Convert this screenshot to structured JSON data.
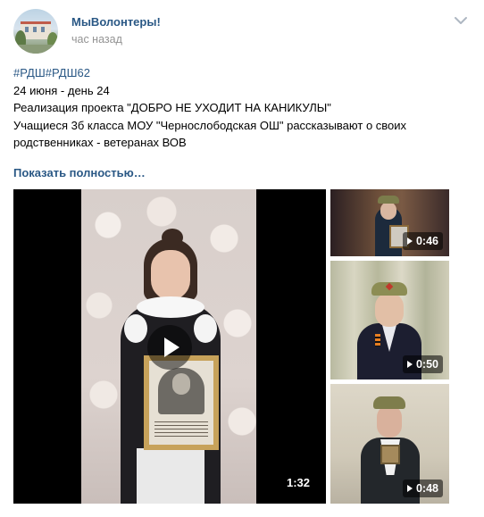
{
  "header": {
    "group_name": "МыВолонтеры!",
    "timestamp": "час назад",
    "menu_icon": "chevron-down-icon"
  },
  "post": {
    "lines": [
      "#РДШ#РДШ62",
      "24 июня - день 24",
      "Реализация проекта \"ДОБРО НЕ УХОДИТ НА КАНИКУЛЫ\"",
      "Учащиеся 3б класса МОУ \"Чернослободская ОШ\" рассказывают о своих",
      "родственниках - ветеранах ВОВ"
    ],
    "show_more": "Показать полностью…"
  },
  "videos": {
    "main": {
      "duration": "1:32",
      "play_icon": "play-icon"
    },
    "thumb1": {
      "duration": "0:46"
    },
    "thumb2": {
      "duration": "0:50"
    },
    "thumb3": {
      "duration": "0:48"
    }
  },
  "colors": {
    "link": "#2a5885",
    "meta": "#939393"
  }
}
